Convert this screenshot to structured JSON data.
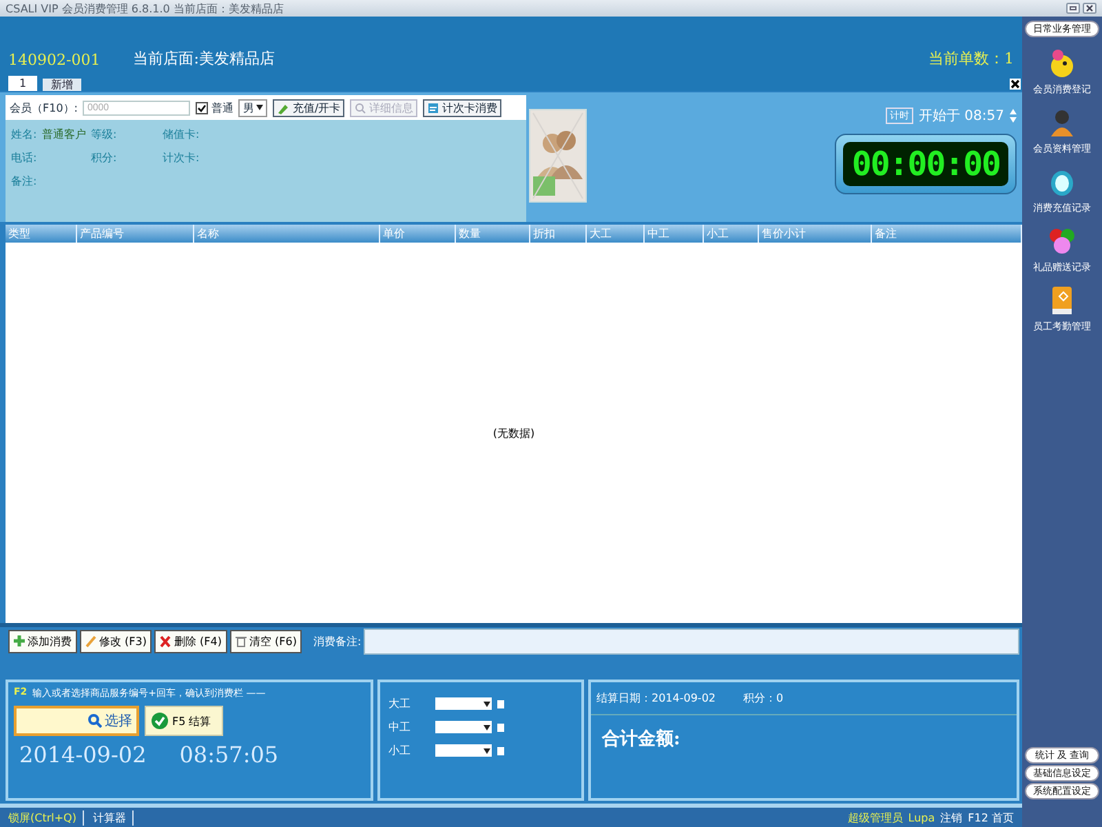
{
  "window": {
    "title": "CSALI VIP 会员消费管理 6.8.1.0 当前店面：美发精品店"
  },
  "header": {
    "order_no": "140902-001",
    "store": "当前店面:美发精品店",
    "count": "当前单数：1"
  },
  "tabs": [
    {
      "label": "1",
      "selected": true
    },
    {
      "label": "新增",
      "selected": false
    }
  ],
  "member": {
    "label": "会员（F10）:",
    "placeholder": "0000",
    "normal": {
      "label": "普通",
      "checked": true
    },
    "gender": "男",
    "buttons": [
      {
        "label": "充值/开卡",
        "disabled": false
      },
      {
        "label": "详细信息",
        "disabled": true
      },
      {
        "label": "计次卡消费",
        "disabled": false
      }
    ],
    "fields": [
      {
        "label": "姓名:",
        "value": "普通客户"
      },
      {
        "label": "等级:"
      },
      {
        "label": "储值卡:"
      },
      {
        "label": "电话:"
      },
      {
        "label": "积分:"
      },
      {
        "label": "计次卡:"
      },
      {
        "label": "备注:"
      }
    ]
  },
  "timer": {
    "label": "计时",
    "start": "开始于 08:57",
    "display": "00:00:00"
  },
  "table": {
    "columns": [
      "类型",
      "产品编号",
      "名称",
      "单价",
      "数量",
      "折扣",
      "大工",
      "中工",
      "小工",
      "售价小计",
      "备注"
    ],
    "empty": "(无数据)"
  },
  "actions": [
    {
      "label": "添加消费"
    },
    {
      "label": "修改 (F3)"
    },
    {
      "label": "删除 (F4)"
    },
    {
      "label": "清空 (F6)"
    }
  ],
  "note_label": "消费备注:",
  "entry": {
    "key": "F2",
    "hint": "输入或者选择商品服务编号+回车，确认到消费栏 ——",
    "select": "选择",
    "checkout": "F5 结算",
    "date": "2014-09-02",
    "time": "08:57:05"
  },
  "workers": [
    {
      "label": "大工",
      "checked": false
    },
    {
      "label": "中工",
      "checked": false
    },
    {
      "label": "小工",
      "checked": false
    }
  ],
  "summary": {
    "date": "结算日期：2014-09-02",
    "points": "积分：0",
    "total": "合计金额:"
  },
  "sidebar": {
    "header": "日常业务管理",
    "items": [
      "会员消费登记",
      "会员资料管理",
      "消费充值记录",
      "礼品赠送记录",
      "员工考勤管理"
    ],
    "bottom": [
      "统计 及 查询",
      "基础信息设定",
      "系统配置设定"
    ]
  },
  "status": {
    "left": [
      "锁屏(Ctrl+Q)",
      "计算器"
    ],
    "user_role": "超级管理员",
    "user": "Lupa",
    "links": [
      "注销",
      "F12 首页"
    ]
  }
}
